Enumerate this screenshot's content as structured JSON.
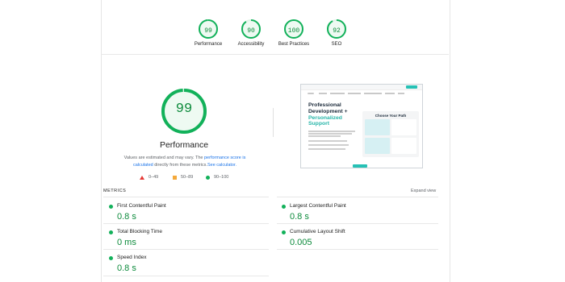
{
  "top_gauges": [
    {
      "score": "99",
      "label": "Performance"
    },
    {
      "score": "90",
      "label": "Accessibility"
    },
    {
      "score": "100",
      "label": "Best Practices"
    },
    {
      "score": "92",
      "label": "SEO"
    }
  ],
  "performance": {
    "score": "99",
    "title": "Performance",
    "note_part1": "Values are estimated and may vary. The ",
    "note_link1": "performance score is calculated",
    "note_part2": " directly from these metrics.",
    "note_link2": "See calculator."
  },
  "legend": {
    "fail": "0–49",
    "average": "50–89",
    "pass": "90–100"
  },
  "preview": {
    "title_line1": "Professional",
    "title_line2": "Development +",
    "title_line3": "Personalized",
    "title_line4": "Support",
    "box_title": "Choose Your Path"
  },
  "metrics": {
    "heading": "METRICS",
    "expand_label": "Expand view",
    "items": [
      {
        "name": "First Contentful Paint",
        "value": "0.8 s"
      },
      {
        "name": "Largest Contentful Paint",
        "value": "0.8 s"
      },
      {
        "name": "Total Blocking Time",
        "value": "0 ms"
      },
      {
        "name": "Cumulative Layout Shift",
        "value": "0.005"
      },
      {
        "name": "Speed Index",
        "value": "0.8 s"
      }
    ]
  },
  "colors": {
    "pass": "#0c8a3b",
    "pass_ring": "#12b15a",
    "ring_bg": "#dff3e6",
    "link": "#1a73e8"
  }
}
